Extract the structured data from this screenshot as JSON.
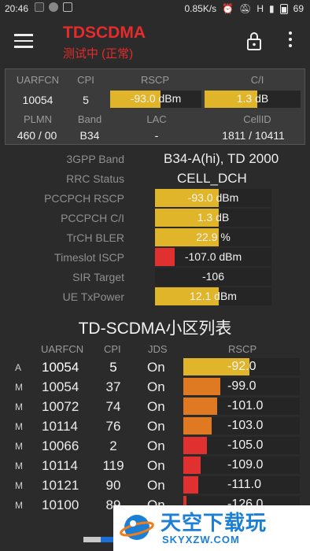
{
  "status_bar": {
    "time": "20:46",
    "net_speed": "0.85K/s",
    "network_type": "H",
    "battery": "69"
  },
  "app_bar": {
    "title": "TDSCDMA",
    "subtitle": "测试中 (正常)",
    "icons": [
      "menu-icon",
      "lock-icon",
      "more-vert-icon"
    ]
  },
  "summary": {
    "headers1": {
      "uarfcn": "UARFCN",
      "cpi": "CPI",
      "rscp": "RSCP",
      "ci": "C/I"
    },
    "values1": {
      "uarfcn": "10054",
      "cpi": "5",
      "rscp": "-93.0 dBm",
      "ci": "1.3 dB"
    },
    "rscp_level": 0.55,
    "ci_level": 0.55,
    "headers2": {
      "plmn": "PLMN",
      "band": "Band",
      "lac": "LAC",
      "cellid": "CellID"
    },
    "values2": {
      "plmn": "460 / 00",
      "band": "B34",
      "lac": "-",
      "cellid": "1811 / 10411"
    }
  },
  "details": [
    {
      "label": "3GPP Band",
      "value": "B34-A(hi), TD 2000"
    },
    {
      "label": "RRC Status",
      "value": "CELL_DCH"
    },
    {
      "label": "PCCPCH RSCP",
      "value": "-93.0 dBm",
      "level": 0.55,
      "color": "#e1b52a"
    },
    {
      "label": "PCCPCH C/I",
      "value": "1.3 dB",
      "level": 0.55,
      "color": "#e1b52a"
    },
    {
      "label": "TrCH BLER",
      "value": "22.9 %",
      "level": 0.55,
      "color": "#e1b52a"
    },
    {
      "label": "Timeslot ISCP",
      "value": "-107.0 dBm",
      "level": 0.17,
      "color": "#e03030"
    },
    {
      "label": "SIR Target",
      "value": "-106",
      "level": 0,
      "color": "#e1b52a"
    },
    {
      "label": "UE TxPower",
      "value": "12.1 dBm",
      "level": 0.55,
      "color": "#e1b52a"
    }
  ],
  "cell_list": {
    "title": "TD-SCDMA小区列表",
    "headers": {
      "uarfcn": "UARFCN",
      "cpi": "CPI",
      "jds": "JDS",
      "rscp": "RSCP"
    },
    "rows": [
      {
        "type": "A",
        "uarfcn": "10054",
        "cpi": "5",
        "jds": "On",
        "rscp": "-92.0",
        "level": 0.57,
        "color": "#e1b52a"
      },
      {
        "type": "M",
        "uarfcn": "10054",
        "cpi": "37",
        "jds": "On",
        "rscp": "-99.0",
        "level": 0.32,
        "color": "#e07a22"
      },
      {
        "type": "M",
        "uarfcn": "10072",
        "cpi": "74",
        "jds": "On",
        "rscp": "-101.0",
        "level": 0.29,
        "color": "#e07a22"
      },
      {
        "type": "M",
        "uarfcn": "10114",
        "cpi": "76",
        "jds": "On",
        "rscp": "-103.0",
        "level": 0.24,
        "color": "#e07a22"
      },
      {
        "type": "M",
        "uarfcn": "10066",
        "cpi": "2",
        "jds": "On",
        "rscp": "-105.0",
        "level": 0.2,
        "color": "#e03030"
      },
      {
        "type": "M",
        "uarfcn": "10114",
        "cpi": "119",
        "jds": "On",
        "rscp": "-109.0",
        "level": 0.15,
        "color": "#e03030"
      },
      {
        "type": "M",
        "uarfcn": "10121",
        "cpi": "90",
        "jds": "On",
        "rscp": "-111.0",
        "level": 0.13,
        "color": "#e03030"
      },
      {
        "type": "M",
        "uarfcn": "10100",
        "cpi": "89",
        "jds": "On",
        "rscp": "-126.0",
        "level": 0.03,
        "color": "#e03030"
      }
    ]
  },
  "watermark": {
    "brand": "天空下载玩",
    "domain": "SKYXZW.COM"
  }
}
